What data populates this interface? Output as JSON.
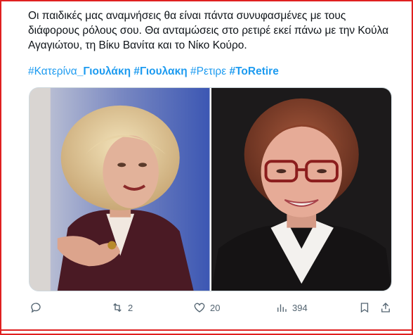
{
  "tweet": {
    "text_line1": "Οι παιδικές μας αναμνήσεις θα είναι πάντα συνυφασμένες με τους",
    "text_line2": "διάφορους ρόλους σου. Θα ανταμώσεις στο ρετιρέ εκεί πάνω με την Κούλα",
    "text_line3": "Αγαγιώτου, τη Βίκυ Βανίτα και το Νίκο Κούρο.",
    "hashtags": [
      {
        "prefix": "#Κατερίνα",
        "bold": "_Γιουλάκη"
      },
      {
        "prefix": "",
        "bold": "#Γιουλακη"
      },
      {
        "prefix": "#Ρετιρε",
        "bold": ""
      },
      {
        "prefix": "",
        "bold": "#ToRetire"
      }
    ]
  },
  "media": {
    "left_photo": "older-tv-still-portrait",
    "right_photo": "recent-portrait-with-glasses"
  },
  "actions": {
    "reply_count": "",
    "retweet_count": "2",
    "like_count": "20",
    "views_count": "394"
  },
  "colors": {
    "accent": "#1d9bf0",
    "frame": "#e02020",
    "muted": "#536471"
  }
}
